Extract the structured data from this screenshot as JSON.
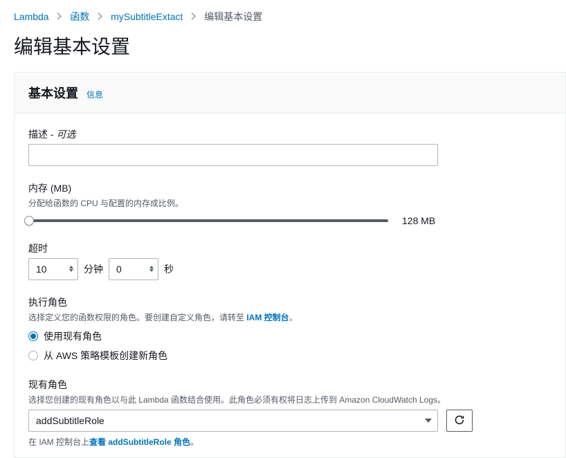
{
  "breadcrumbs": {
    "lambda": "Lambda",
    "functions": "函数",
    "fn": "mySubtitleExtact",
    "current": "编辑基本设置"
  },
  "page_title": "编辑基本设置",
  "panel": {
    "title": "基本设置",
    "info": "信息"
  },
  "description": {
    "label_prefix": "描述 - ",
    "optional": "可选",
    "value": ""
  },
  "memory": {
    "label": "内存 (MB)",
    "desc": "分配给函数的 CPU 与配置的内存成比例。",
    "value_text": "128 MB"
  },
  "timeout": {
    "label": "超时",
    "minutes": "10",
    "minutes_unit": "分钟",
    "seconds": "0",
    "seconds_unit": "秒"
  },
  "exec_role": {
    "label": "执行角色",
    "desc_pre": "选择定义您的函数权限的角色。要创建自定义角色，请转至 ",
    "desc_link": "IAM 控制台",
    "desc_post": "。",
    "opt_existing": "使用现有角色",
    "opt_template": "从 AWS 策略模板创建新角色"
  },
  "existing_role": {
    "label": "现有角色",
    "desc": "选择您创建的现有角色以与此 Lambda 函数结合使用。此角色必须有权将日志上传到 Amazon CloudWatch Logs。",
    "selected": "addSubtitleRole",
    "view_pre": "在 IAM 控制台上",
    "view_link": "查看 addSubtitleRole 角色",
    "view_post": "。"
  }
}
